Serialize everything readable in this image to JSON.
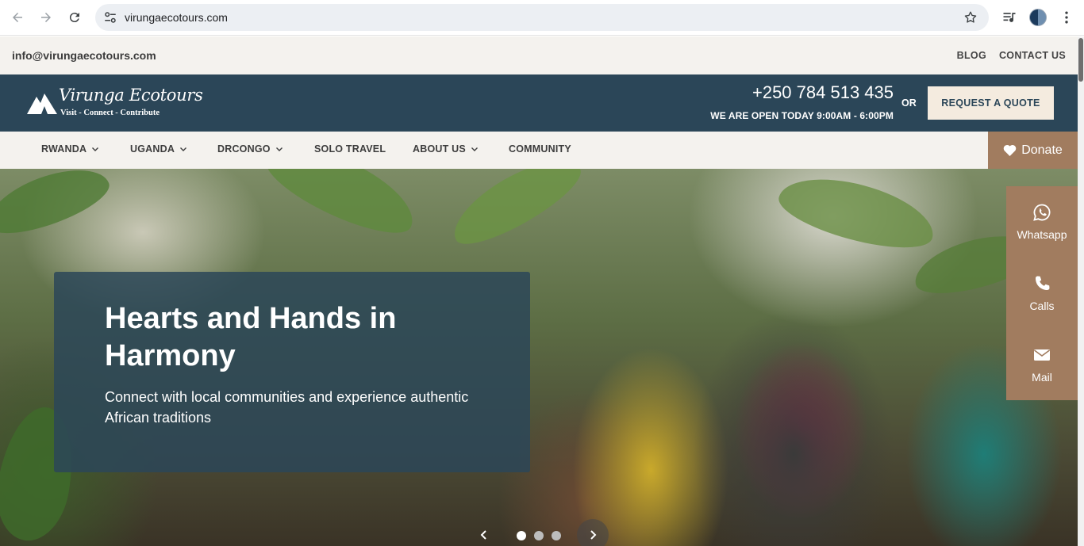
{
  "browser": {
    "url": "virungaecotours.com",
    "icons": {
      "back": "back-arrow-icon",
      "forward": "forward-arrow-icon",
      "reload": "reload-icon",
      "site_info": "site-settings-icon",
      "bookmark": "star-icon",
      "media": "media-controls-icon",
      "menu": "kebab-menu-icon"
    }
  },
  "topbar": {
    "email": "info@virungaecotours.com",
    "links": [
      "BLOG",
      "CONTACT US"
    ]
  },
  "header": {
    "logo": {
      "wordmark": "Virunga Ecotours",
      "tagline": "Visit - Connect - Contribute"
    },
    "phone": "+250 784 513 435",
    "hours": "WE ARE OPEN TODAY 9:00AM - 6:00PM",
    "or_label": "OR",
    "quote_button": "REQUEST A QUOTE"
  },
  "nav": {
    "items": [
      {
        "label": "RWANDA",
        "dropdown": true
      },
      {
        "label": "UGANDA",
        "dropdown": true
      },
      {
        "label": "DRCONGO",
        "dropdown": true
      },
      {
        "label": "SOLO TRAVEL",
        "dropdown": false
      },
      {
        "label": "ABOUT US",
        "dropdown": true
      },
      {
        "label": "COMMUNITY",
        "dropdown": false
      }
    ],
    "donate_label": "Donate"
  },
  "hero": {
    "title": "Hearts and Hands in Harmony",
    "subtitle": "Connect with local communities and experience authentic African traditions",
    "slides_total": 3,
    "active_slide": 1
  },
  "side_panel": {
    "items": [
      {
        "label": "Whatsapp",
        "icon": "whatsapp-icon"
      },
      {
        "label": "Calls",
        "icon": "phone-icon"
      },
      {
        "label": "Mail",
        "icon": "mail-icon"
      }
    ]
  },
  "colors": {
    "header_bg": "#2b4658",
    "accent_brown": "#a17c5f",
    "topbar_bg": "#f4f2ee",
    "quote_button_bg": "#f4ebdf"
  }
}
